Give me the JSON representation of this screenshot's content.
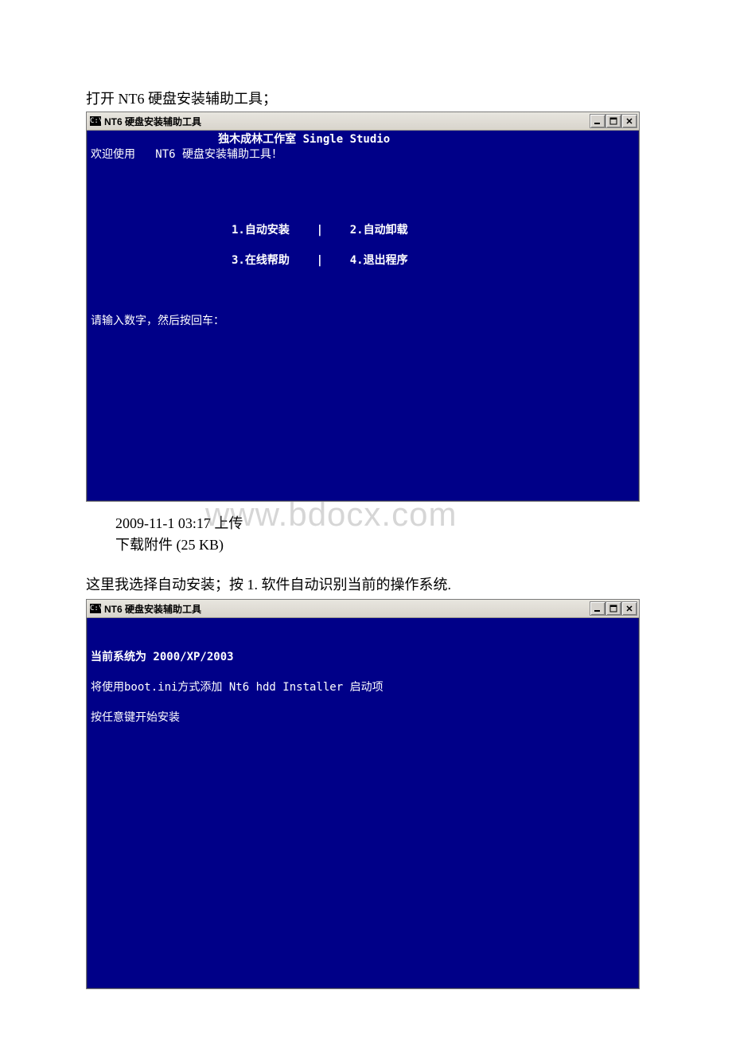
{
  "doc": {
    "caption1": "打开 NT6 硬盘安装辅助工具；",
    "upload_line": "2009-11-1 03:17 上传",
    "download_line": "下载附件 (25 KB)",
    "caption2": "这里我选择自动安装；按 1.  软件自动识别当前的操作系统.",
    "watermark": "www.bdocx.com"
  },
  "window1": {
    "icon": "C:\\",
    "title": "NT6 硬盘安装辅助工具",
    "studio_line": "                   独木成林工作室 Single Studio",
    "welcome_line": "欢迎使用   NT6 硬盘安装辅助工具！",
    "menu_row1": "                     1.自动安装    |    2.自动卸载",
    "menu_row2": "                     3.在线帮助    |    4.退出程序",
    "prompt": "请输入数字，然后按回车："
  },
  "window2": {
    "icon": "C:\\",
    "title": "NT6 硬盘安装辅助工具",
    "line1": "当前系统为 2000/XP/2003",
    "line2": "将使用boot.ini方式添加 Nt6 hdd Installer 启动项",
    "line3": "按任意键开始安装"
  }
}
